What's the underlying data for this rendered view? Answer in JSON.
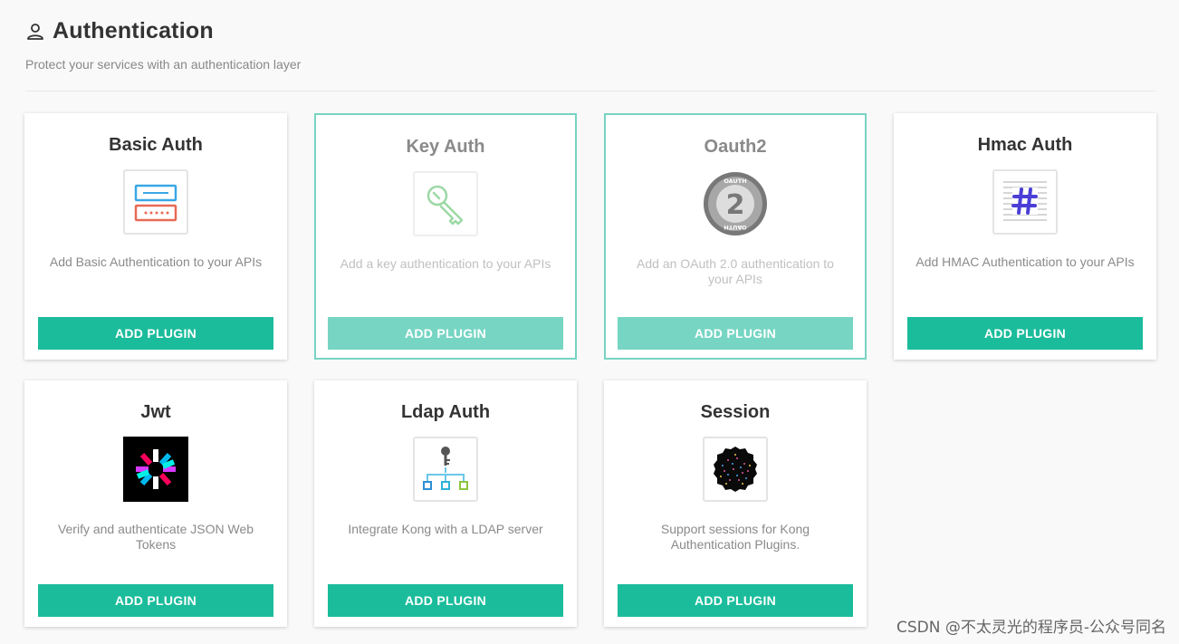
{
  "header": {
    "title": "Authentication",
    "subtitle": "Protect your services with an authentication layer"
  },
  "plugins": [
    {
      "name": "Basic Auth",
      "description": "Add Basic Authentication to your APIs",
      "button": "ADD PLUGIN",
      "icon": "basic-auth-icon",
      "enabled": false
    },
    {
      "name": "Key Auth",
      "description": "Add a key authentication to your APIs",
      "button": "ADD PLUGIN",
      "icon": "key-icon",
      "enabled": true
    },
    {
      "name": "Oauth2",
      "description": "Add an OAuth 2.0 authentication to your APIs",
      "button": "ADD PLUGIN",
      "icon": "oauth2-icon",
      "icon_text": {
        "top": "OAUTH",
        "number": "2",
        "bottom": "OAUTH"
      },
      "enabled": true
    },
    {
      "name": "Hmac Auth",
      "description": "Add HMAC Authentication to your APIs",
      "button": "ADD PLUGIN",
      "icon": "hash-icon",
      "enabled": false
    },
    {
      "name": "Jwt",
      "description": "Verify and authenticate JSON Web Tokens",
      "button": "ADD PLUGIN",
      "icon": "jwt-icon",
      "enabled": false
    },
    {
      "name": "Ldap Auth",
      "description": "Integrate Kong with a LDAP server",
      "button": "ADD PLUGIN",
      "icon": "ldap-icon",
      "enabled": false
    },
    {
      "name": "Session",
      "description": "Support sessions for Kong Authentication Plugins.",
      "button": "ADD PLUGIN",
      "icon": "session-icon",
      "enabled": false
    }
  ],
  "colors": {
    "accent": "#1bbc9b",
    "accent_light": "#76d5c3",
    "enabled_border": "#78d3c2"
  },
  "watermark": "CSDN @不太灵光的程序员-公众号同名"
}
